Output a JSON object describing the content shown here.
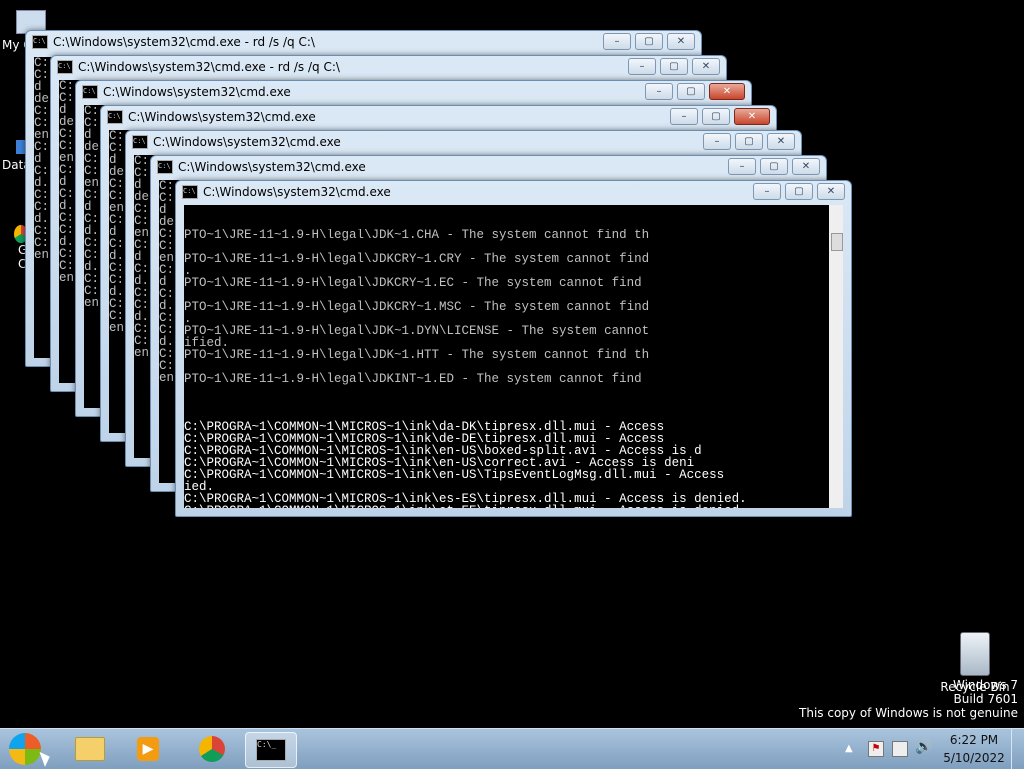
{
  "desktop": {
    "icons": [
      {
        "label": "My C",
        "icon": "computer-icon"
      },
      {
        "label": "Data",
        "icon": "data-icon"
      },
      {
        "label": "G",
        "icon": "chrome-icon"
      },
      {
        "label": "C",
        "icon": "chrome-icon-label"
      }
    ],
    "recycle_bin": {
      "label": "Recycle Bin",
      "icon": "recycle-bin-icon"
    }
  },
  "windows": {
    "w1_title": "C:\\Windows\\system32\\cmd.exe - rd  /s /q C:\\",
    "w2_title": "C:\\Windows\\system32\\cmd.exe - rd  /s /q C:\\",
    "w3_title": "C:\\Windows\\system32\\cmd.exe",
    "w4_title": "C:\\Windows\\system32\\cmd.exe",
    "w5_title": "C:\\Windows\\system32\\cmd.exe",
    "w6_title": "C:\\Windows\\system32\\cmd.exe",
    "w7_title": "C:\\Windows\\system32\\cmd.exe"
  },
  "console": {
    "front_text": "PTO~1\\JRE-11~1.9-H\\legal\\JDK~1.CHA - The system cannot find th\n\nPTO~1\\JRE-11~1.9-H\\legal\\JDKCRY~1.CRY - The system cannot find\n.\nPTO~1\\JRE-11~1.9-H\\legal\\JDKCRY~1.EC - The system cannot find\n\nPTO~1\\JRE-11~1.9-H\\legal\\JDKCRY~1.MSC - The system cannot find\n.\nPTO~1\\JRE-11~1.9-H\\legal\\JDK~1.DYN\\LICENSE - The system cannot\nified.\nPTO~1\\JRE-11~1.9-H\\legal\\JDK~1.HTT - The system cannot find th\n\nPTO~1\\JRE-11~1.9-H\\legal\\JDKINT~1.ED - The system cannot find",
    "back_text": "C:\\PROGRA~1\\COMMON~1\\MICROS~1\\ink\\da-DK\\tipresx.dll.mui - Access\nC:\\PROGRA~1\\COMMON~1\\MICROS~1\\ink\\de-DE\\tipresx.dll.mui - Access\nC:\\PROGRA~1\\COMMON~1\\MICROS~1\\ink\\en-US\\boxed-split.avi - Access is d\nC:\\PROGRA~1\\COMMON~1\\MICROS~1\\ink\\en-US\\correct.avi - Access is deni\nC:\\PROGRA~1\\COMMON~1\\MICROS~1\\ink\\en-US\\TipsEventLogMsg.dll.mui - Access\nied.\nC:\\PROGRA~1\\COMMON~1\\MICROS~1\\ink\\es-ES\\tipresx.dll.mui - Access is denied.\nC:\\PROGRA~1\\COMMON~1\\MICROS~1\\ink\\et-EE\\tipresx.dll.mui - Access is denied.\nC:\\PROGRA~1\\COMMON~1\\MICROS~1\\ink\\fi-FI\\tipresx.dll.mui - Access is denied.\nC:\\PROGRA~1\\COMMON~1\\MICROS~1\\ink\\FlickAnimation.avi - Access is denied.\nC:\\PROGRA~1\\COMMON~1\\MICROS~1\\ink\\FlickLearningWizard.exe - Access is denied.\nC:\\PROGRA~1\\COMMON~1\\MICROS~1\\ink\\fr-FR\\tipresx.dll.mui -",
    "right_fragments": [
      "e is",
      "denie",
      "s is d",
      "ed.",
      "denie"
    ],
    "left_fragments": "C:\nC:\nd\nde\nC:\nC:\nen\nC:\nd\nC:\nd.\nC:\nC:\nd.\nC:\nC:\nen"
  },
  "taskbar": {
    "start_icon": "windows-start-icon",
    "pinned": [
      {
        "name": "explorer",
        "icon": "folder-icon"
      },
      {
        "name": "media-player",
        "icon": "media-player-icon"
      },
      {
        "name": "chrome",
        "icon": "chrome-icon"
      },
      {
        "name": "cmd",
        "icon": "cmd-icon"
      }
    ],
    "time": "6:22 PM",
    "date": "5/10/2022"
  },
  "watermark": {
    "line1": "Windows 7",
    "line2": "Build 7601",
    "line3": "This copy of Windows is not genuine"
  }
}
